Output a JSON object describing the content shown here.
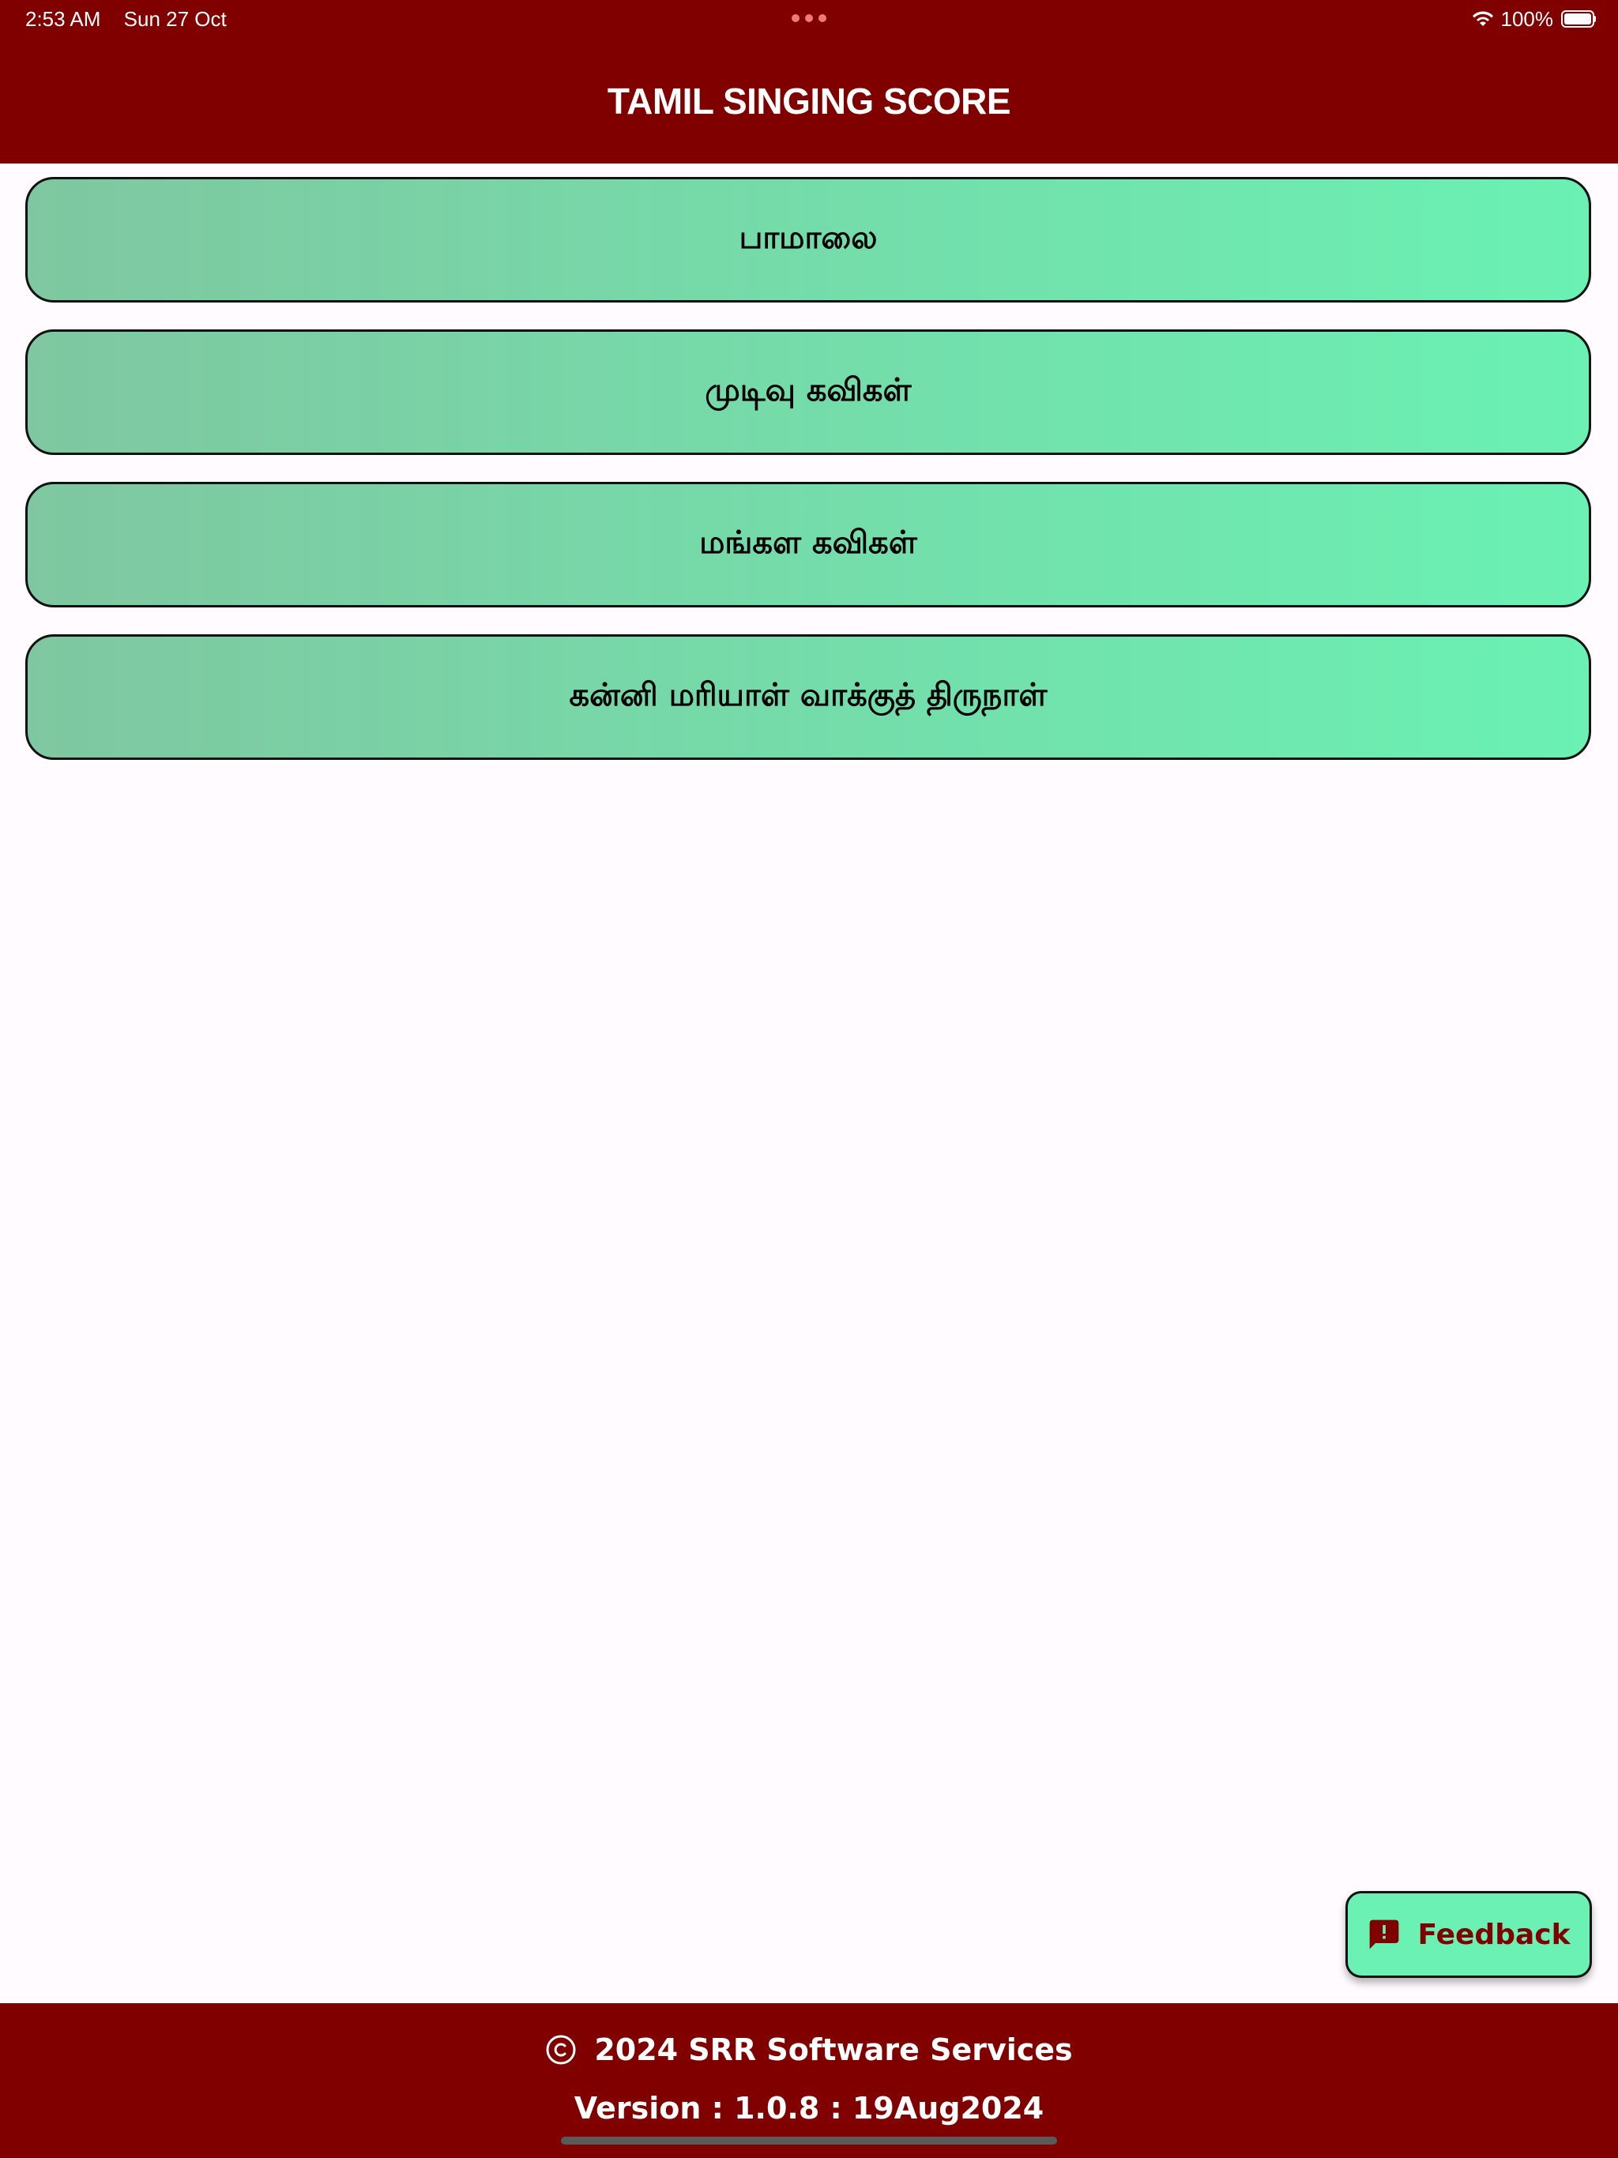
{
  "status_bar": {
    "time": "2:53 AM",
    "date": "Sun 27 Oct",
    "battery_percent": "100%",
    "battery_level": 1.0,
    "icons": [
      "wifi-icon",
      "battery-icon",
      "multitask-dots-icon"
    ]
  },
  "header": {
    "title": "TAMIL SINGING SCORE"
  },
  "menu": {
    "items": [
      {
        "label": "பாமாலை"
      },
      {
        "label": "முடிவு கவிகள்"
      },
      {
        "label": "மங்கள கவிகள்"
      },
      {
        "label": "கன்னி மரியாள்  வாக்குத் திருநாள்"
      }
    ]
  },
  "fab": {
    "label": "Feedback",
    "icon": "feedback-icon"
  },
  "footer": {
    "copyright_icon": "copyright-icon",
    "copyright_text": "2024 SRR Software Services",
    "version_text": "Version : 1.0.8 : 19Aug2024"
  },
  "colors": {
    "brand": "#800000",
    "accent": "#6af1b3",
    "button_gradient_start": "#7fc7a0",
    "button_gradient_end": "#6af1b3",
    "background": "#fffbfe"
  }
}
